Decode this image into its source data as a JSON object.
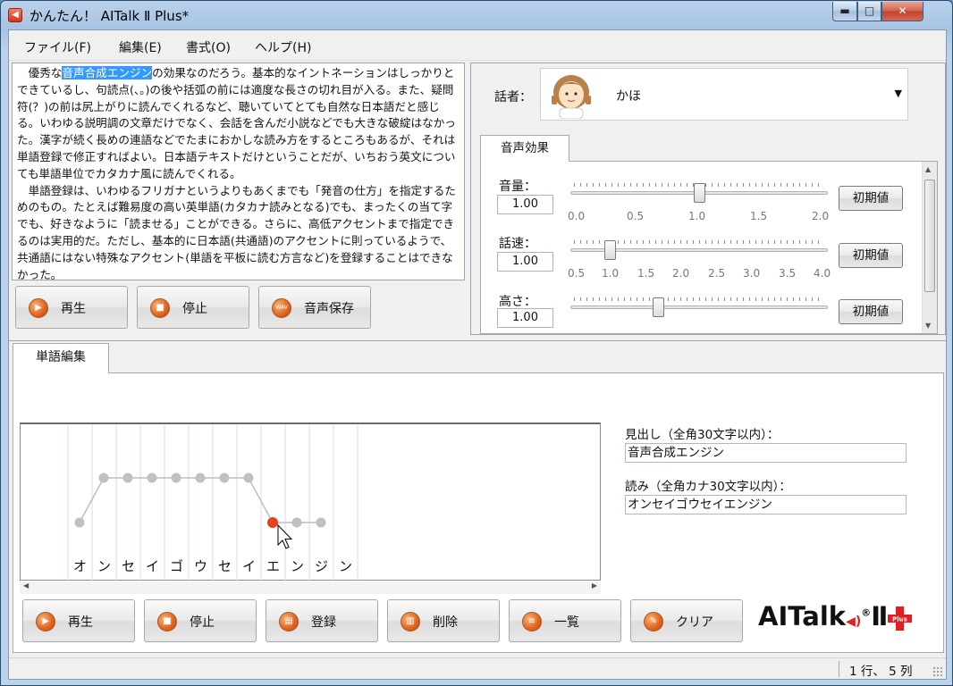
{
  "window": {
    "title": "かんたん！ AITalk Ⅱ Plus*",
    "minimize": "▬",
    "maximize": "□",
    "close": "✕"
  },
  "menu": [
    "ファイル(F)",
    "編集(E)",
    "書式(O)",
    "ヘルプ(H)"
  ],
  "editor": {
    "para1_pre": "優秀な",
    "para1_selected": "音声合成エンジン",
    "para1_post": "の効果なのだろう。基本的なイントネーションはしっかりとできているし、句読点(、。)の後や括弧の前には適度な長さの切れ目が入る。また、疑問符(？)の前は尻上がりに読んでくれるなど、聴いていてとても自然な日本語だと感じる。いわゆる説明調の文章だけでなく、会話を含んだ小説などでも大きな破綻はなかった。漢字が続く長めの連語などでたまにおかしな読み方をするところもあるが、それは単語登録で修正すればよい。日本語テキストだけということだが、いちおう英文についても単語単位でカタカナ風に読んでくれる。",
    "para2": "単語登録は、いわゆるフリガナというよりもあくまでも「発音の仕方」を指定するためのもの。たとえば難易度の高い英単語(カタカナ読みとなる)でも、まったくの当て字でも、好きなように「読ませる」ことができる。さらに、高低アクセントまで指定できるのは実用的だ。ただし、基本的に日本語(共通語)のアクセントに則っているようで、共通語にはない特殊なアクセント(単語を平板に読む方言など)を登録することはできなかった。"
  },
  "top_buttons": {
    "play": "再生",
    "stop": "停止",
    "save_audio": "音声保存",
    "wav_icon_text": "WAV"
  },
  "speaker": {
    "label": "話者：",
    "name": "かほ"
  },
  "voice_tab": "音声効果",
  "params": [
    {
      "label": "音量：",
      "value": "1.00",
      "ticks": [
        "0.0",
        "0.5",
        "1.0",
        "1.5",
        "2.0"
      ],
      "level": 0.5,
      "reset": "初期値"
    },
    {
      "label": "話速：",
      "value": "1.00",
      "ticks": [
        "0.5",
        "1.0",
        "1.5",
        "2.0",
        "2.5",
        "3.0",
        "3.5",
        "4.0"
      ],
      "level": 0.143,
      "reset": "初期値"
    },
    {
      "label": "高さ：",
      "value": "1.00",
      "reset": "初期値"
    }
  ],
  "word_tab": "単語編集",
  "accent": {
    "kana": [
      "オ",
      "ン",
      "セ",
      "イ",
      "ゴ",
      "ウ",
      "セ",
      "イ",
      "エ",
      "ン",
      "ジ",
      "ン"
    ],
    "pitch": [
      0,
      1,
      1,
      1,
      1,
      1,
      1,
      1,
      0,
      0,
      0
    ],
    "selected_index": 8
  },
  "fields": {
    "heading_label": "見出し（全角30文字以内）：",
    "heading_value": "音声合成エンジン",
    "reading_label": "読み（全角カナ30文字以内）：",
    "reading_value": "オンセイゴウセイエンジン"
  },
  "bottom_buttons": {
    "play": "再生",
    "stop": "停止",
    "register": "登録",
    "delete": "削除",
    "list": "一覧",
    "clear": "クリア"
  },
  "logo": {
    "text": "AITalk",
    "registered": "®",
    "roman": "Ⅱ",
    "plus": "Plus"
  },
  "status": "1 行、 5 列",
  "colors": {
    "selected_point": "#e8401c",
    "point": "#c0c0c0",
    "line": "#bdbdbd",
    "button_icon": "#e0621c",
    "logo_red": "#e02020"
  }
}
